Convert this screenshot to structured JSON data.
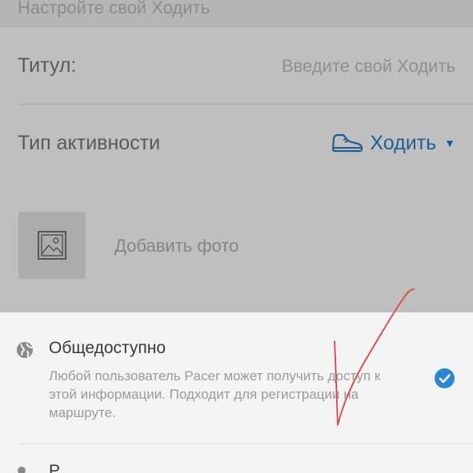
{
  "header": {
    "section_title": "Настройте свой Ходить"
  },
  "form": {
    "title_label": "Титул:",
    "title_placeholder": "Введите свой Ходить",
    "activity_label": "Тип активности",
    "activity_value": "Ходить",
    "photo_label": "Добавить фото"
  },
  "privacy_sheet": {
    "public_option": {
      "title": "Общедоступно",
      "description": "Любой пользователь Pacer может получить доступ к этой информации. Подходит для регистрации на маршруте.",
      "selected": true
    }
  },
  "colors": {
    "accent_blue": "#1e5f93",
    "check_blue": "#2a87d8",
    "annotation_red": "#e2463a"
  },
  "icons": {
    "activity": "shoe-icon",
    "photo": "image-icon",
    "visibility": "globe-icon",
    "selected": "checkmark-circle-icon"
  }
}
